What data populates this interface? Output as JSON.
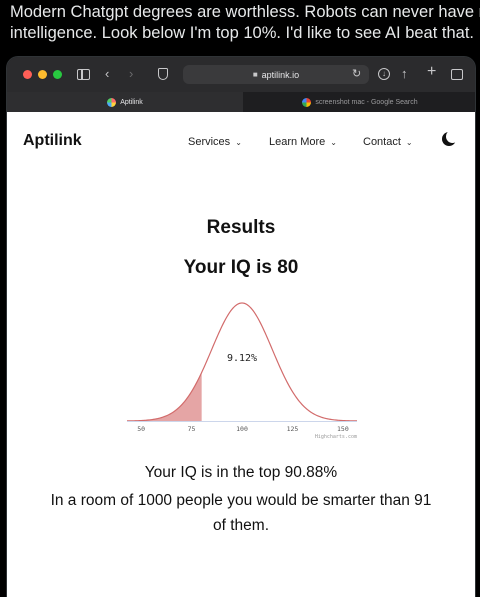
{
  "post": {
    "line1": "Modern Chatgpt degrees are worthless. Robots can never have re",
    "line2": "intelligence. Look below I'm top 10%. I'd like to see AI beat that."
  },
  "browser": {
    "address": "aptilink.io",
    "tabs": [
      {
        "label": "Aptilink",
        "active": true,
        "favicon": "aptilink-favicon"
      },
      {
        "label": "screenshot mac - Google Search",
        "active": false,
        "favicon": "google-favicon"
      }
    ]
  },
  "site": {
    "logo": "Aptilink",
    "nav": {
      "services": "Services",
      "learn_more": "Learn More",
      "contact": "Contact"
    }
  },
  "results": {
    "heading": "Results",
    "iq_line": "Your IQ is 80",
    "summary_top": "Your IQ is in the top 90.88%",
    "summary_room_1": "In a room of 1000 people you would be smarter than 91",
    "summary_room_2": "of them."
  },
  "chart_data": {
    "type": "area",
    "distribution": "normal",
    "mean": 100,
    "sd": 15,
    "x_ticks": [
      "50",
      "75",
      "100",
      "125",
      "150"
    ],
    "xlim": [
      43,
      157
    ],
    "shaded_upto": 80,
    "shaded_label": "9.12%",
    "credit": "Highcharts.com",
    "colors": {
      "line": "#d26b6b",
      "fill": "#e5a5a5"
    }
  }
}
